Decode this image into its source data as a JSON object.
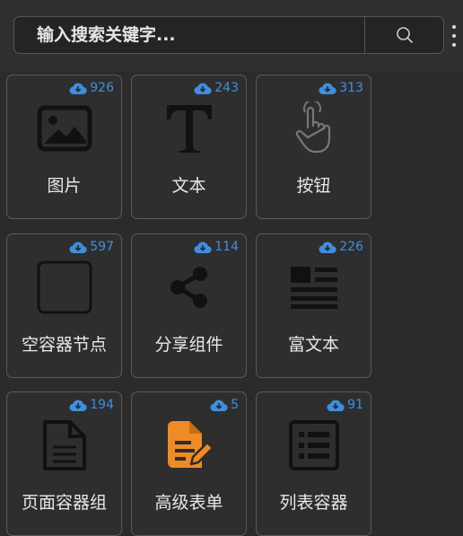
{
  "search": {
    "placeholder": "输入搜索关键字..."
  },
  "components": [
    {
      "label": "图片",
      "count": "926",
      "icon": "image-icon"
    },
    {
      "label": "文本",
      "count": "243",
      "icon": "text-icon"
    },
    {
      "label": "按钮",
      "count": "313",
      "icon": "pointer-hand-icon"
    },
    {
      "label": "空容器节点",
      "count": "597",
      "icon": "square-icon"
    },
    {
      "label": "分享组件",
      "count": "114",
      "icon": "share-icon"
    },
    {
      "label": "富文本",
      "count": "226",
      "icon": "rich-text-icon"
    },
    {
      "label": "页面容器组",
      "count": "194",
      "icon": "document-icon"
    },
    {
      "label": "高级表单",
      "count": "5",
      "icon": "form-edit-icon"
    },
    {
      "label": "列表容器",
      "count": "91",
      "icon": "list-icon"
    }
  ],
  "colors": {
    "download": "#3d8fe0",
    "form_icon": "#f08a24",
    "background": "#2b2b2b"
  }
}
